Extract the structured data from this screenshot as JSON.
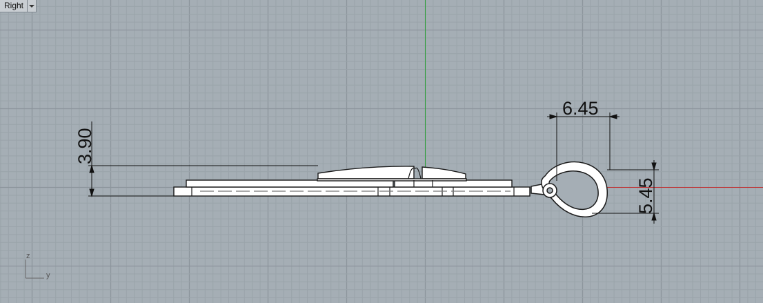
{
  "viewport": {
    "name": "Right",
    "background": "#a5aeb5",
    "grid_minor_color": "#9aa3aa",
    "grid_major_color": "#8c959c",
    "y_axis_color": "#c03030",
    "z_axis_color": "#2e9e3a"
  },
  "dimensions": {
    "height_left": "3.90",
    "bail_width": "6.45",
    "bail_height": "5.45"
  },
  "axis_widget": {
    "vertical_label": "z",
    "horizontal_label": "y"
  }
}
